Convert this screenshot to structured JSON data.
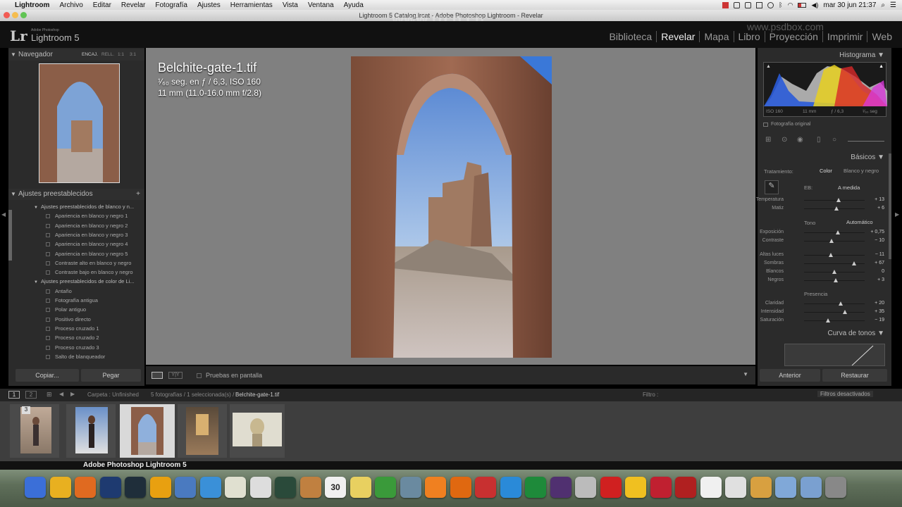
{
  "menubar": {
    "app": "Lightroom",
    "items": [
      "Archivo",
      "Editar",
      "Revelar",
      "Fotografía",
      "Ajustes",
      "Herramientas",
      "Vista",
      "Ventana",
      "Ayuda"
    ],
    "clock": "mar 30 jun  21:37"
  },
  "window_title": "Lightroom 5 Catalog.lrcat - Adobe Photoshop Lightroom - Revelar",
  "watermark_site": "www.rrcg.cn",
  "watermark_site2": "www.psdbox.com",
  "identity": {
    "logo": "Lr",
    "subtitle": "Adobe Photoshop",
    "product": "Lightroom 5",
    "modules": [
      "Biblioteca",
      "Revelar",
      "Mapa",
      "Libro",
      "Proyección",
      "Imprimir",
      "Web"
    ],
    "active_module": "Revelar"
  },
  "left_panel": {
    "navigator_title": "Navegador",
    "nav_modes": [
      "ENCAJ.",
      "RELL.",
      "1:1",
      "3:1"
    ],
    "presets_title": "Ajustes preestablecidos",
    "presets": [
      {
        "label": "Ajustes preestablecidos de blanco y n...",
        "group": true
      },
      {
        "label": "Apariencia en blanco y negro 1"
      },
      {
        "label": "Apariencia en blanco y negro 2"
      },
      {
        "label": "Apariencia en blanco y negro 3"
      },
      {
        "label": "Apariencia en blanco y negro 4"
      },
      {
        "label": "Apariencia en blanco y negro 5"
      },
      {
        "label": "Contraste alto en blanco y negro"
      },
      {
        "label": "Contraste bajo en blanco y negro"
      },
      {
        "label": "Ajustes preestablecidos de color de Li...",
        "group": true
      },
      {
        "label": "Antaño"
      },
      {
        "label": "Fotografía antigua"
      },
      {
        "label": "Polar antiguo"
      },
      {
        "label": "Positivo directo"
      },
      {
        "label": "Proceso cruzado 1"
      },
      {
        "label": "Proceso cruzado 2"
      },
      {
        "label": "Proceso cruzado 3"
      },
      {
        "label": "Salto de blanqueador"
      }
    ],
    "copy_button": "Copiar...",
    "paste_button": "Pegar"
  },
  "photo_info": {
    "filename": "Belchite-gate-1.tif",
    "exposure": "¹⁄₆₀ seg. en ƒ / 6,3, ISO 160",
    "lens": "11 mm (11.0-16.0 mm f/2.8)"
  },
  "toolbar": {
    "softproof_label": "Pruebas en pantalla"
  },
  "right_panel": {
    "histogram_title": "Histograma",
    "hist_info": [
      "ISO 160",
      "11 mm",
      "ƒ / 6,3",
      "¹⁄₆₀ seg"
    ],
    "original_photo": "Fotografía original",
    "basic_title": "Básicos",
    "treatment_label": "Tratamiento:",
    "treatment_color": "Color",
    "treatment_bw": "Blanco y negro",
    "wb_label": "EB:",
    "wb_value": "A medida",
    "tone_label": "Tono",
    "auto_label": "Automático",
    "presence_label": "Presencia",
    "tone_curve_title": "Curva de tonos",
    "sliders": [
      {
        "label": "Temperatura",
        "value": "+ 13",
        "pos": 0.57
      },
      {
        "label": "Matiz",
        "value": "+ 6",
        "pos": 0.53
      },
      {
        "label": "Exposición",
        "value": "+ 0,75",
        "pos": 0.56
      },
      {
        "label": "Contraste",
        "value": "− 10",
        "pos": 0.45
      },
      {
        "label": "Altas luces",
        "value": "− 11",
        "pos": 0.44
      },
      {
        "label": "Sombras",
        "value": "+ 67",
        "pos": 0.83
      },
      {
        "label": "Blancos",
        "value": "0",
        "pos": 0.5
      },
      {
        "label": "Negros",
        "value": "+ 3",
        "pos": 0.52
      },
      {
        "label": "Claridad",
        "value": "+ 20",
        "pos": 0.6
      },
      {
        "label": "Intensidad",
        "value": "+ 35",
        "pos": 0.67
      },
      {
        "label": "Saturación",
        "value": "− 19",
        "pos": 0.4
      }
    ],
    "prev_button": "Anterior",
    "reset_button": "Restaurar"
  },
  "filmstrip_bar": {
    "pages": [
      "1",
      "2"
    ],
    "folder": "Carpeta : Unfinished",
    "count": "5 fotografías / 1 seleccionada(s) /",
    "current": "Belchite-gate-1.tif",
    "filter_label": "Filtro :",
    "filter_value": "Filtros desactivados"
  },
  "filmstrip": {
    "stack_badge": "3",
    "selected_index": 2
  },
  "dock_tooltip": "Adobe Photoshop Lightroom 5",
  "dock_icons": [
    "finder-icon",
    "chrome-icon",
    "firefox-icon",
    "photoshop-icon",
    "lightroom-icon",
    "outlook-icon",
    "preview-icon",
    "safari-icon",
    "textedit-icon",
    "launchpad-icon",
    "activity-icon",
    "contacts-icon",
    "calendar-icon",
    "stickies-icon",
    "camtasia-icon",
    "app-icon",
    "vlc-icon",
    "illustrator-icon",
    "wunderlist-icon",
    "coda-icon",
    "excel-icon",
    "finalcut-icon",
    "calculator-icon",
    "typora-icon",
    "cyberduck-icon",
    "mindmap-icon",
    "filezilla-icon",
    "notes-icon",
    "document-icon",
    "downloads-icon",
    "folder-icon",
    "applications-icon",
    "trash-icon"
  ],
  "calendar_day": "30",
  "colors": {
    "panel": "#2b2b2b",
    "center": "#808080",
    "accent": "#eeeeee"
  }
}
